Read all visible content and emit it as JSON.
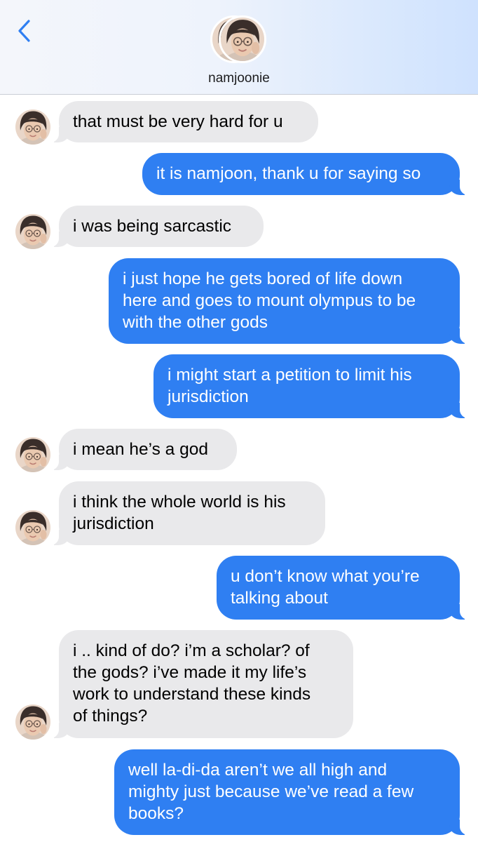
{
  "header": {
    "back_label": "back",
    "back_icon": "chevron-left-icon",
    "contact_name": "namjoonie",
    "accent_color": "#2f7ff2"
  },
  "messages": [
    {
      "side": "received",
      "text": "that must be very hard for u"
    },
    {
      "side": "sent",
      "text": "it is namjoon, thank u for saying so"
    },
    {
      "side": "received",
      "text": "i was being sarcastic"
    },
    {
      "side": "sent",
      "text": "i just hope he gets bored of life down\nhere and goes to mount olympus to be\nwith the other gods"
    },
    {
      "side": "sent",
      "text": "i might start a petition to limit his\njurisdiction"
    },
    {
      "side": "received",
      "text": "i mean he’s a god"
    },
    {
      "side": "received",
      "text": "i think the whole world is his\njurisdiction"
    },
    {
      "side": "sent",
      "text": "u don’t know what you’re\ntalking about"
    },
    {
      "side": "received",
      "text": "i .. kind of do? i’m a scholar? of\nthe gods? i’ve made it my life’s\nwork to understand these kinds\nof things?"
    },
    {
      "side": "sent",
      "text": "well la-di-da aren’t we all high and\nmighty just because we’ve read a few\nbooks?"
    }
  ]
}
